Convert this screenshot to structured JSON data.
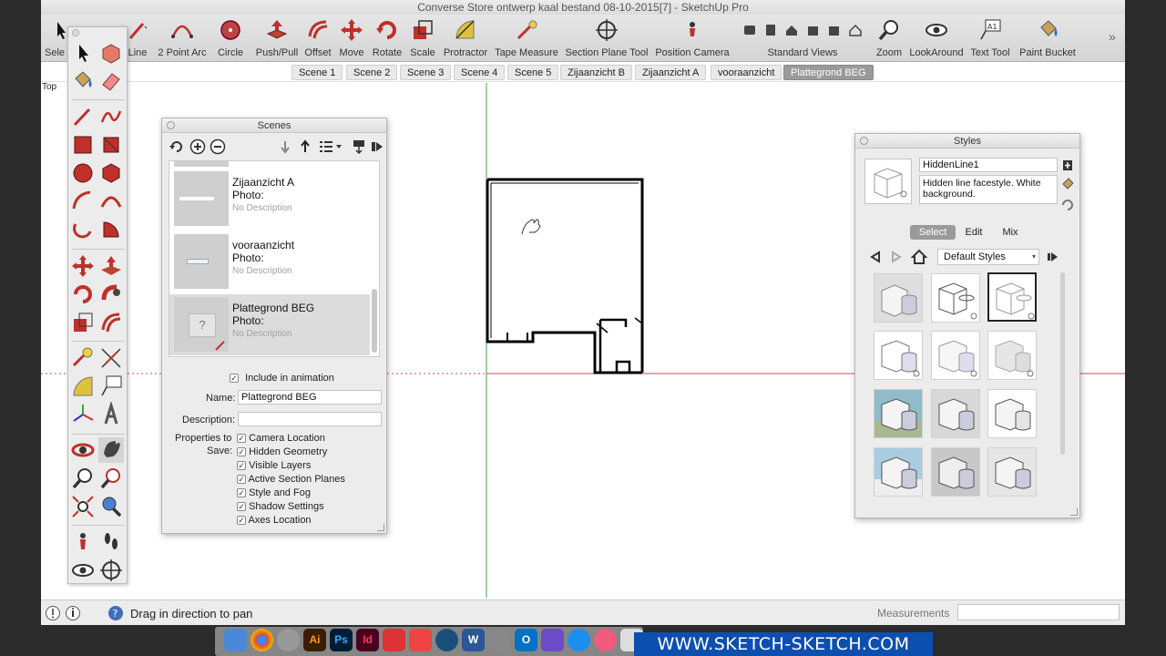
{
  "window": {
    "title": "Converse Store ontwerp kaal bestand 08-10-2015[7] - SketchUp Pro"
  },
  "toolbar": {
    "items": [
      {
        "label": "Sele",
        "icon": "select-arrow-icon"
      },
      {
        "label": "Line",
        "icon": "line-pencil-icon"
      },
      {
        "label": "2 Point Arc",
        "icon": "two-point-arc-icon"
      },
      {
        "label": "Circle",
        "icon": "circle-icon"
      },
      {
        "label": "Push/Pull",
        "icon": "push-pull-icon"
      },
      {
        "label": "Offset",
        "icon": "offset-icon"
      },
      {
        "label": "Move",
        "icon": "move-icon"
      },
      {
        "label": "Rotate",
        "icon": "rotate-icon"
      },
      {
        "label": "Scale",
        "icon": "scale-icon"
      },
      {
        "label": "Protractor",
        "icon": "protractor-icon"
      },
      {
        "label": "Tape Measure",
        "icon": "tape-measure-icon"
      },
      {
        "label": "Section Plane Tool",
        "icon": "section-plane-icon"
      },
      {
        "label": "Position Camera",
        "icon": "position-camera-icon"
      },
      {
        "label": "Standard Views",
        "icon": "standard-views-icon"
      },
      {
        "label": "Zoom",
        "icon": "zoom-icon"
      },
      {
        "label": "LookAround",
        "icon": "look-around-icon"
      },
      {
        "label": "Text Tool",
        "icon": "text-tool-icon"
      },
      {
        "label": "Paint Bucket",
        "icon": "paint-bucket-icon"
      }
    ]
  },
  "scene_tabs": [
    "Scene 1",
    "Scene 2",
    "Scene 3",
    "Scene 4",
    "Scene 5",
    "Zijaanzicht B",
    "Zijaanzicht A",
    "vooraanzicht",
    "Plattegrond BEG"
  ],
  "active_scene_tab": "Plattegrond BEG",
  "view_label": "Top",
  "scenes_panel": {
    "title": "Scenes",
    "list": [
      {
        "name": "Zijaanzicht A",
        "photo": "Photo:",
        "description": "No Description"
      },
      {
        "name": "vooraanzicht",
        "photo": "Photo:",
        "description": "No Description"
      },
      {
        "name": "Plattegrond BEG",
        "photo": "Photo:",
        "description": "No Description"
      }
    ],
    "include_animation": "Include in animation",
    "name_label": "Name:",
    "name_value": "Plattegrond BEG",
    "description_label": "Description:",
    "description_value": "",
    "properties_label_1": "Properties to",
    "properties_label_2": "Save:",
    "properties": [
      "Camera Location",
      "Hidden Geometry",
      "Visible Layers",
      "Active Section Planes",
      "Style and Fog",
      "Shadow Settings",
      "Axes Location"
    ]
  },
  "styles_panel": {
    "title": "Styles",
    "style_name": "HiddenLine1",
    "style_description": "Hidden line facestyle. White background.",
    "tabs": [
      "Select",
      "Edit",
      "Mix"
    ],
    "active_tab": "Select",
    "collection": "Default Styles"
  },
  "status": {
    "hint": "Drag in direction to pan",
    "measurements_label": "Measurements",
    "measurements_value": ""
  },
  "dock": {
    "apps": [
      "finder-icon",
      "chrome-icon",
      "launchpad-icon",
      "illustrator-icon",
      "photoshop-icon",
      "indesign-icon",
      "sketchup-icon",
      "layout-icon",
      "camtasia-icon",
      "word-icon",
      "system-prefs-icon",
      "outlook-icon",
      "imovie-icon",
      "app-store-icon",
      "itunes-icon",
      "apple-icon"
    ],
    "ai": "Ai",
    "ps": "Ps",
    "id": "Id",
    "w": "W",
    "o": "O"
  },
  "watermark": "WWW.SKETCH-SKETCH.COM",
  "colors": {
    "accent_red": "#d2322a",
    "axis_green": "#3aa13a",
    "axis_red": "#c65050",
    "watermark_blue": "#0c4fb0"
  }
}
